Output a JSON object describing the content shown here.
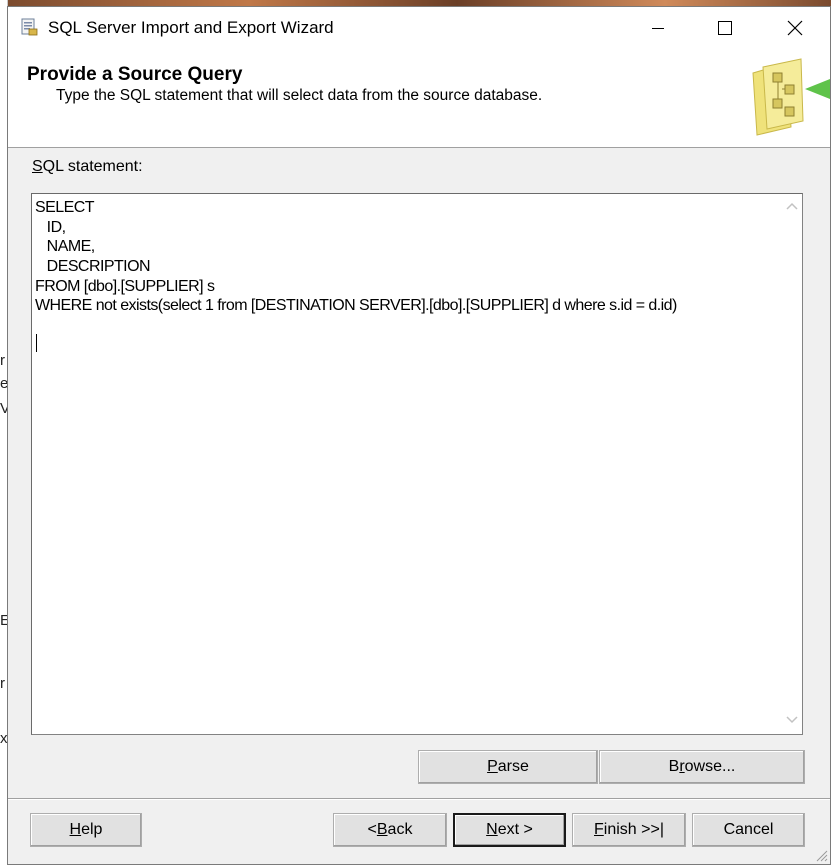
{
  "window": {
    "title": "SQL Server Import and Export Wizard"
  },
  "header": {
    "title": "Provide a Source Query",
    "subtitle": "Type the SQL statement that will select data from the source database."
  },
  "sql": {
    "label_prefix": "",
    "label_mnemonic": "S",
    "label_rest": "QL statement:",
    "lines": [
      "SELECT",
      "   ID,",
      "   NAME,",
      "   DESCRIPTION",
      "FROM [dbo].[SUPPLIER] s",
      "WHERE not exists(select 1 from [DESTINATION SERVER].[dbo].[SUPPLIER] d where s.id = d.id)"
    ]
  },
  "buttons": {
    "parse": {
      "mn": "P",
      "rest": "arse"
    },
    "browse": {
      "pre": "B",
      "mn": "r",
      "rest": "owse..."
    },
    "help": {
      "mn": "H",
      "rest": "elp"
    },
    "back": {
      "pre": "< ",
      "mn": "B",
      "rest": "ack"
    },
    "next": {
      "mn": "N",
      "rest": "ext >"
    },
    "finish": {
      "mn": "F",
      "rest": "inish >>|"
    },
    "cancel": {
      "label": "Cancel"
    }
  },
  "background_fragments": [
    "r",
    "e",
    "V",
    "E",
    "r",
    "x"
  ]
}
